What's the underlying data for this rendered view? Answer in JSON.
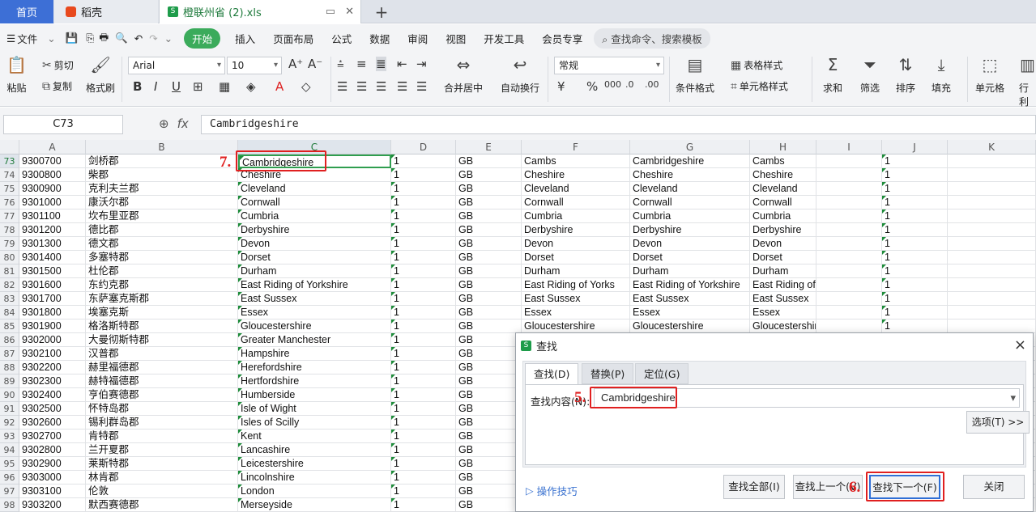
{
  "tabs": {
    "home": "首页",
    "daoke": "稻壳",
    "file": "橙联州省 (2).xls",
    "add": "+"
  },
  "menu": {
    "file": "文件",
    "kaishi": "开始",
    "items": [
      "插入",
      "页面布局",
      "公式",
      "数据",
      "审阅",
      "视图",
      "开发工具",
      "会员专享"
    ],
    "search": "查找命令、搜索模板"
  },
  "ribbon": {
    "paste": "粘贴",
    "cut": "剪切",
    "copy": "复制",
    "format_painter": "格式刷",
    "font_name": "Arial",
    "font_size": "10",
    "merge": "合并居中",
    "wrap": "自动换行",
    "number_format": "常规",
    "cond_format": "条件格式",
    "table_style": "表格样式",
    "cell_style": "单元格样式",
    "sum": "求和",
    "filter": "筛选",
    "sort": "排序",
    "fill": "填充",
    "cell": "单元格",
    "rowcol": "行利"
  },
  "formula": {
    "name_box": "C73",
    "value": "Cambridgeshire"
  },
  "columns": [
    "A",
    "B",
    "C",
    "D",
    "E",
    "F",
    "G",
    "H",
    "I",
    "J",
    "K"
  ],
  "rows": [
    {
      "n": "73",
      "a": "9300700",
      "b": "剑桥郡",
      "c": "Cambridgeshire",
      "d": "1",
      "e": "GB",
      "f": "Cambs",
      "g": "Cambridgeshire",
      "h": "Cambs",
      "j": "1"
    },
    {
      "n": "74",
      "a": "9300800",
      "b": "柴郡",
      "c": "Cheshire",
      "d": "1",
      "e": "GB",
      "f": "Cheshire",
      "g": "Cheshire",
      "h": "Cheshire",
      "j": "1"
    },
    {
      "n": "75",
      "a": "9300900",
      "b": "克利夫兰郡",
      "c": "Cleveland",
      "d": "1",
      "e": "GB",
      "f": "Cleveland",
      "g": "Cleveland",
      "h": "Cleveland",
      "j": "1"
    },
    {
      "n": "76",
      "a": "9301000",
      "b": "康沃尔郡",
      "c": "Cornwall",
      "d": "1",
      "e": "GB",
      "f": "Cornwall",
      "g": "Cornwall",
      "h": "Cornwall",
      "j": "1"
    },
    {
      "n": "77",
      "a": "9301100",
      "b": "坎布里亚郡",
      "c": "Cumbria",
      "d": "1",
      "e": "GB",
      "f": "Cumbria",
      "g": "Cumbria",
      "h": "Cumbria",
      "j": "1"
    },
    {
      "n": "78",
      "a": "9301200",
      "b": "德比郡",
      "c": "Derbyshire",
      "d": "1",
      "e": "GB",
      "f": "Derbyshire",
      "g": "Derbyshire",
      "h": "Derbyshire",
      "j": "1"
    },
    {
      "n": "79",
      "a": "9301300",
      "b": "德文郡",
      "c": "Devon",
      "d": "1",
      "e": "GB",
      "f": "Devon",
      "g": "Devon",
      "h": "Devon",
      "j": "1"
    },
    {
      "n": "80",
      "a": "9301400",
      "b": "多塞特郡",
      "c": "Dorset",
      "d": "1",
      "e": "GB",
      "f": "Dorset",
      "g": "Dorset",
      "h": "Dorset",
      "j": "1"
    },
    {
      "n": "81",
      "a": "9301500",
      "b": "杜伦郡",
      "c": "Durham",
      "d": "1",
      "e": "GB",
      "f": "Durham",
      "g": "Durham",
      "h": "Durham",
      "j": "1"
    },
    {
      "n": "82",
      "a": "9301600",
      "b": "东约克郡",
      "c": "East Riding of Yorkshire",
      "d": "1",
      "e": "GB",
      "f": "East Riding of Yorks",
      "g": "East Riding of Yorkshire",
      "h": "East Riding of Yorkshire",
      "j": "1"
    },
    {
      "n": "83",
      "a": "9301700",
      "b": "东萨塞克斯郡",
      "c": "East Sussex",
      "d": "1",
      "e": "GB",
      "f": "East Sussex",
      "g": "East Sussex",
      "h": "East Sussex",
      "j": "1"
    },
    {
      "n": "84",
      "a": "9301800",
      "b": "埃塞克斯",
      "c": "Essex",
      "d": "1",
      "e": "GB",
      "f": "Essex",
      "g": "Essex",
      "h": "Essex",
      "j": "1"
    },
    {
      "n": "85",
      "a": "9301900",
      "b": "格洛斯特郡",
      "c": "Gloucestershire",
      "d": "1",
      "e": "GB",
      "f": "Gloucestershire",
      "g": "Gloucestershire",
      "h": "Gloucestershire",
      "j": "1"
    },
    {
      "n": "86",
      "a": "9302000",
      "b": "大曼彻斯特郡",
      "c": "Greater Manchester",
      "d": "1",
      "e": "GB",
      "f": "",
      "g": "",
      "h": "",
      "j": ""
    },
    {
      "n": "87",
      "a": "9302100",
      "b": "汉普郡",
      "c": "Hampshire",
      "d": "1",
      "e": "GB",
      "f": "",
      "g": "",
      "h": "",
      "j": ""
    },
    {
      "n": "88",
      "a": "9302200",
      "b": "赫里福德郡",
      "c": "Herefordshire",
      "d": "1",
      "e": "GB",
      "f": "",
      "g": "",
      "h": "",
      "j": ""
    },
    {
      "n": "89",
      "a": "9302300",
      "b": "赫特福德郡",
      "c": "Hertfordshire",
      "d": "1",
      "e": "GB",
      "f": "",
      "g": "",
      "h": "",
      "j": ""
    },
    {
      "n": "90",
      "a": "9302400",
      "b": "亨伯赛德郡",
      "c": "Humberside",
      "d": "1",
      "e": "GB",
      "f": "",
      "g": "",
      "h": "",
      "j": ""
    },
    {
      "n": "91",
      "a": "9302500",
      "b": "怀特岛郡",
      "c": "Isle of Wight",
      "d": "1",
      "e": "GB",
      "f": "",
      "g": "",
      "h": "",
      "j": ""
    },
    {
      "n": "92",
      "a": "9302600",
      "b": "锡利群岛郡",
      "c": "Isles of Scilly",
      "d": "1",
      "e": "GB",
      "f": "",
      "g": "",
      "h": "",
      "j": ""
    },
    {
      "n": "93",
      "a": "9302700",
      "b": "肯特郡",
      "c": "Kent",
      "d": "1",
      "e": "GB",
      "f": "",
      "g": "",
      "h": "",
      "j": ""
    },
    {
      "n": "94",
      "a": "9302800",
      "b": "兰开夏郡",
      "c": "Lancashire",
      "d": "1",
      "e": "GB",
      "f": "",
      "g": "",
      "h": "",
      "j": ""
    },
    {
      "n": "95",
      "a": "9302900",
      "b": "莱斯特郡",
      "c": "Leicestershire",
      "d": "1",
      "e": "GB",
      "f": "",
      "g": "",
      "h": "",
      "j": ""
    },
    {
      "n": "96",
      "a": "9303000",
      "b": "林肯郡",
      "c": "Lincolnshire",
      "d": "1",
      "e": "GB",
      "f": "",
      "g": "",
      "h": "",
      "j": ""
    },
    {
      "n": "97",
      "a": "9303100",
      "b": "伦敦",
      "c": "London",
      "d": "1",
      "e": "GB",
      "f": "",
      "g": "",
      "h": "",
      "j": ""
    },
    {
      "n": "98",
      "a": "9303200",
      "b": "默西赛德郡",
      "c": "Merseyside",
      "d": "1",
      "e": "GB",
      "f": "",
      "g": "",
      "h": "",
      "j": ""
    }
  ],
  "annotations": {
    "step5": "5.",
    "step6": "6.",
    "step7": "7."
  },
  "dialog": {
    "title": "查找",
    "close": "×",
    "tab_find": "查找(D)",
    "tab_replace": "替换(P)",
    "tab_goto": "定位(G)",
    "find_label": "查找内容(N):",
    "find_value": "Cambridgeshire",
    "options": "选项(T) >>",
    "tips": "操作技巧",
    "find_all": "查找全部(I)",
    "find_prev": "查找上一个(V)",
    "find_next": "查找下一个(F)",
    "close_btn": "关闭"
  },
  "colors": {
    "accent_green": "#3bab5b",
    "annotation_red": "#e02020",
    "home_tab_blue": "#3d6fd6"
  }
}
